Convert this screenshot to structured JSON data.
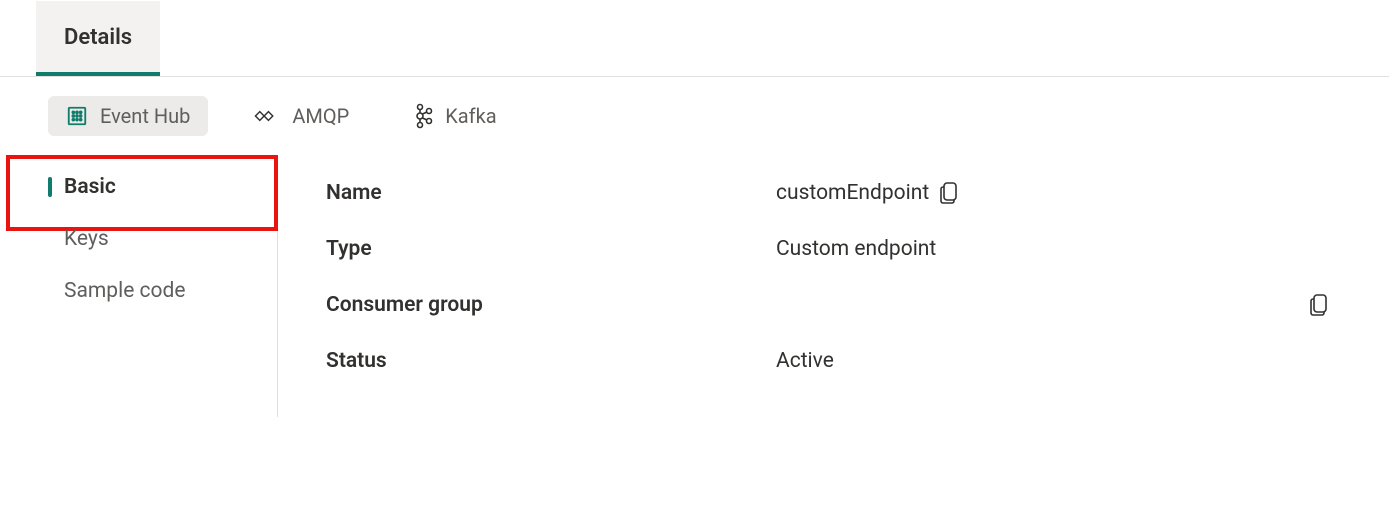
{
  "tabs": {
    "details": "Details"
  },
  "sourceTypes": {
    "eventhub": "Event Hub",
    "amqp": "AMQP",
    "kafka": "Kafka"
  },
  "sidenav": {
    "basic": "Basic",
    "keys": "Keys",
    "samplecode": "Sample code"
  },
  "fields": {
    "name": {
      "label": "Name",
      "value": "customEndpoint"
    },
    "type": {
      "label": "Type",
      "value": "Custom endpoint"
    },
    "consumerGroup": {
      "label": "Consumer group",
      "value": ""
    },
    "status": {
      "label": "Status",
      "value": "Active"
    }
  }
}
